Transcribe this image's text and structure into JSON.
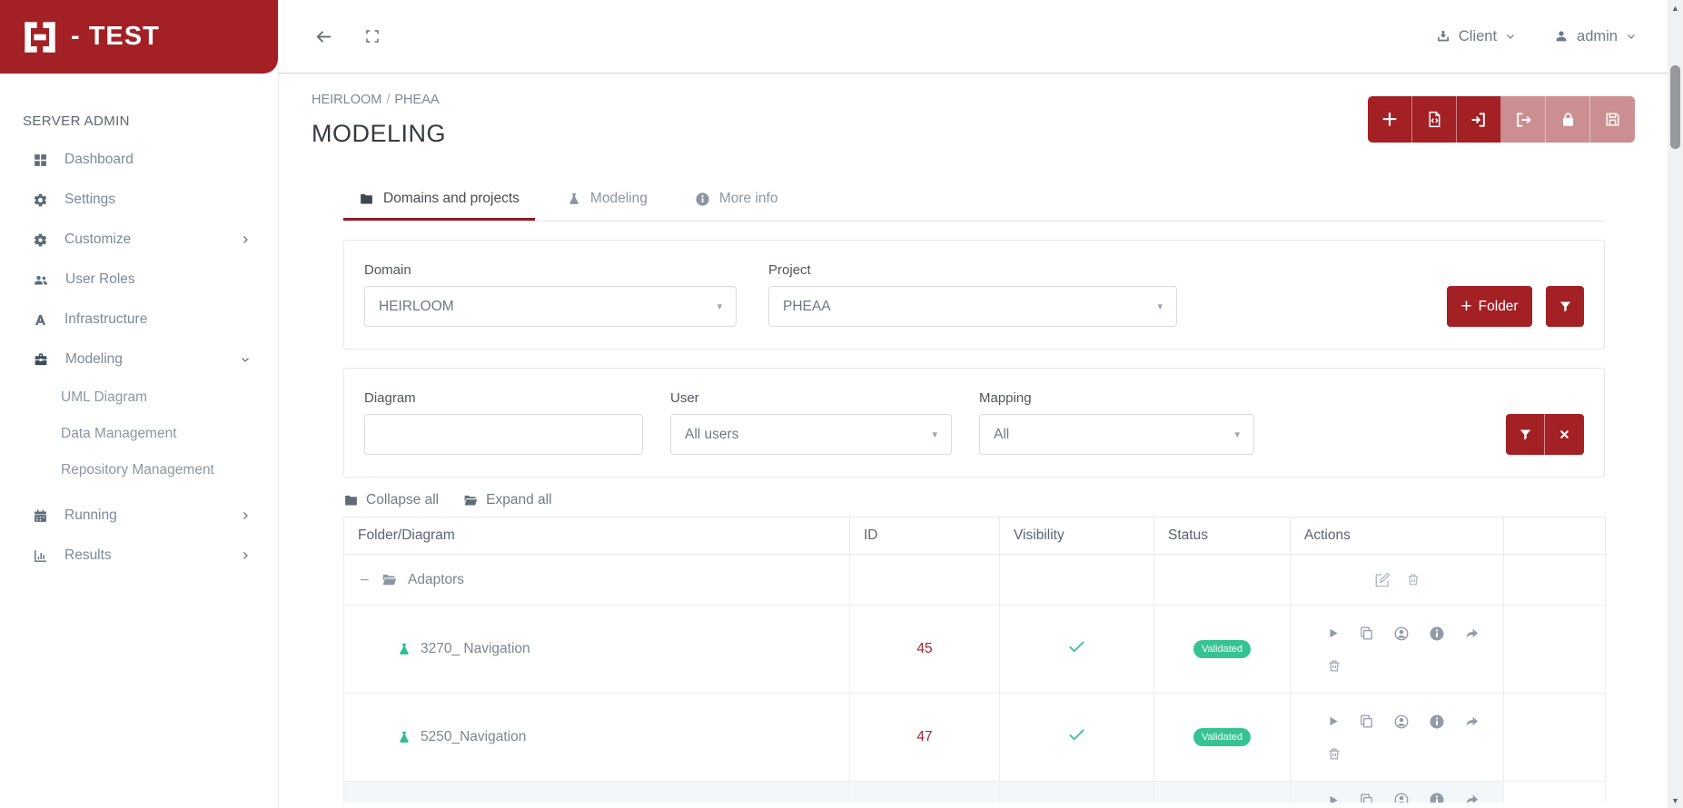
{
  "app": {
    "logo_text": "- TEST"
  },
  "topbar": {
    "client": "Client",
    "user": "admin"
  },
  "sidebar": {
    "title": "SERVER ADMIN",
    "items": [
      {
        "label": "Dashboard"
      },
      {
        "label": "Settings"
      },
      {
        "label": "Customize"
      },
      {
        "label": "User Roles"
      },
      {
        "label": "Infrastructure"
      },
      {
        "label": "Modeling"
      },
      {
        "label": "Running"
      },
      {
        "label": "Results"
      }
    ],
    "children": [
      {
        "label": "UML Diagram"
      },
      {
        "label": "Data Management"
      },
      {
        "label": "Repository Management"
      }
    ]
  },
  "breadcrumb": {
    "parts": [
      "HEIRLOOM",
      "PHEAA"
    ],
    "separator": "/"
  },
  "page": {
    "title": "MODELING"
  },
  "toolbar": {
    "icons": [
      "plus-icon",
      "file-code-icon",
      "sign-in-icon",
      "sign-out-icon",
      "lock-icon",
      "save-icon"
    ],
    "enabled": [
      true,
      true,
      true,
      false,
      false,
      false
    ]
  },
  "tabs": [
    {
      "label": "Domains and projects",
      "icon": "folder-icon",
      "active": true
    },
    {
      "label": "Modeling",
      "icon": "flask-icon",
      "active": false
    },
    {
      "label": "More info",
      "icon": "info-icon",
      "active": false
    }
  ],
  "panels": {
    "domain": {
      "label": "Domain",
      "value": "HEIRLOOM"
    },
    "project": {
      "label": "Project",
      "value": "PHEAA"
    },
    "folder_button": "Folder",
    "diagram": {
      "label": "Diagram",
      "value": ""
    },
    "user": {
      "label": "User",
      "value": "All users"
    },
    "mapping": {
      "label": "Mapping",
      "value": "All"
    }
  },
  "tree": {
    "collapse": "Collapse all",
    "expand": "Expand all"
  },
  "table": {
    "headers": [
      "Folder/Diagram",
      "ID",
      "Visibility",
      "Status",
      "Actions"
    ],
    "folder_row": {
      "name": "Adaptors"
    },
    "rows": [
      {
        "name": "3270_ Navigation",
        "id": "45",
        "visible": true,
        "status": "Validated"
      },
      {
        "name": "5250_Navigation",
        "id": "47",
        "visible": true,
        "status": "Validated"
      }
    ]
  },
  "colors": {
    "primary_red": "#a32025",
    "disabled_red": "#cb8f91",
    "badge_green": "#35c491",
    "check_green": "#34c38f",
    "flask_green": "#2ebd8f",
    "id_red": "#a5282d"
  }
}
